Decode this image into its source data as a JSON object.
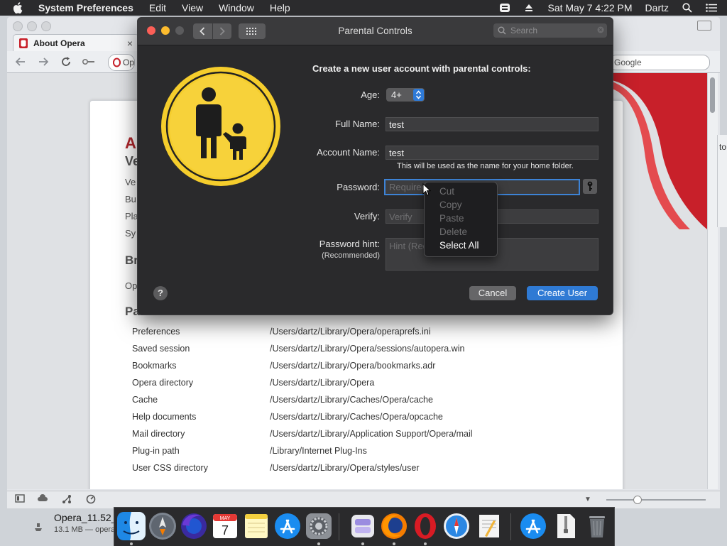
{
  "menubar": {
    "app_name": "System Preferences",
    "menus": [
      "Edit",
      "View",
      "Window",
      "Help"
    ],
    "clock": "Sat May 7  4:22 PM",
    "user": "Dartz"
  },
  "opera": {
    "tab_title": "About Opera",
    "tab_close": "×",
    "address_fragment": "Op",
    "search_placeholder": "Google",
    "heading_red_fragment": "A",
    "left_fragments": [
      "Ve",
      "Ve",
      "Bu",
      "Pla",
      "Sy",
      "Br",
      "Op",
      "Pa"
    ],
    "side_fragment": "to",
    "paths": [
      {
        "key": "Preferences",
        "value": "/Users/dartz/Library/Opera/operaprefs.ini"
      },
      {
        "key": "Saved session",
        "value": "/Users/dartz/Library/Opera/sessions/autopera.win"
      },
      {
        "key": "Bookmarks",
        "value": "/Users/dartz/Library/Opera/bookmarks.adr"
      },
      {
        "key": "Opera directory",
        "value": "/Users/dartz/Library/Opera"
      },
      {
        "key": "Cache",
        "value": "/Users/dartz/Library/Caches/Opera/cache"
      },
      {
        "key": "Help documents",
        "value": "/Users/dartz/Library/Caches/Opera/opcache"
      },
      {
        "key": "Mail directory",
        "value": "/Users/dartz/Library/Application Support/Opera/mail"
      },
      {
        "key": "Plug-in path",
        "value": "/Library/Internet Plug-Ins"
      },
      {
        "key": "User CSS directory",
        "value": "/Users/dartz/Library/Opera/styles/user"
      }
    ]
  },
  "download": {
    "name": "Opera_11.52_",
    "meta": "13.1 MB — opera"
  },
  "window": {
    "title": "Parental Controls",
    "search_placeholder": "Search",
    "heading": "Create a new user account with parental controls:",
    "age_label": "Age:",
    "age_value": "4+",
    "full_name_label": "Full Name:",
    "full_name_value": "test",
    "account_name_label": "Account Name:",
    "account_name_value": "test",
    "home_folder_note": "This will be used as the name for your home folder.",
    "password_label": "Password:",
    "password_placeholder": "Required",
    "verify_label": "Verify:",
    "verify_placeholder": "Verify",
    "hint_label": "Password hint:",
    "hint_sublabel": "(Recommended)",
    "hint_placeholder": "Hint (Recommended)",
    "help_label": "?",
    "cancel_label": "Cancel",
    "create_label": "Create User"
  },
  "context_menu": {
    "items": [
      {
        "label": "Cut",
        "enabled": false
      },
      {
        "label": "Copy",
        "enabled": false
      },
      {
        "label": "Paste",
        "enabled": false
      },
      {
        "label": "Delete",
        "enabled": false
      },
      {
        "label": "Select All",
        "enabled": true
      }
    ]
  },
  "dock": {
    "apps": [
      "finder-icon",
      "launchpad-icon",
      "firefox-nightly-icon",
      "calendar-icon",
      "notes-icon",
      "app-store-icon",
      "system-preferences-icon",
      "opera-installer-icon",
      "firefox-icon",
      "opera-icon",
      "safari-icon",
      "textedit-icon",
      "app-store-downloads-icon",
      "archive-icon",
      "trash-icon"
    ],
    "calendar_month": "MAY",
    "calendar_day": "7"
  },
  "colors": {
    "accent_blue": "#2f7ad4",
    "window_bg": "#2a2a2c",
    "parental_yellow": "#f5cd2c",
    "opera_red": "#c8202a"
  }
}
